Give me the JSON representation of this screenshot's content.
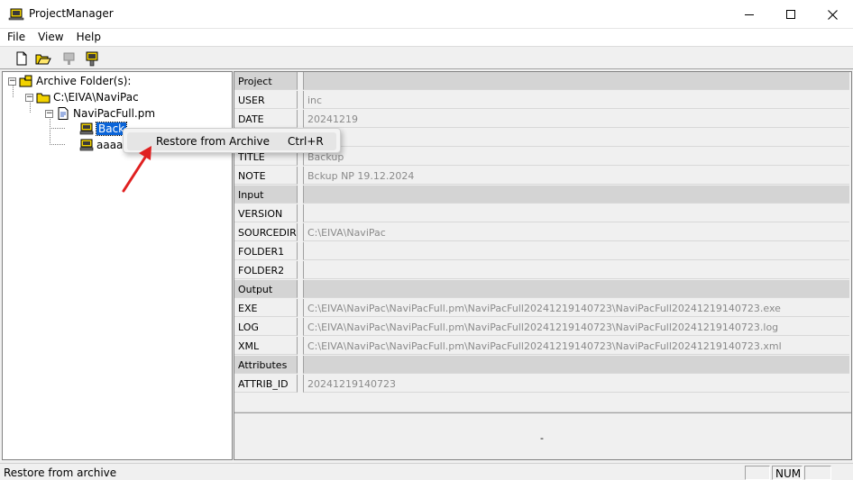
{
  "window": {
    "title": "ProjectManager"
  },
  "menu": {
    "items": [
      "File",
      "View",
      "Help"
    ]
  },
  "toolbar": {
    "buttons": [
      "new-document-icon",
      "open-folder-icon",
      "disconnect-icon",
      "connect-monitor-icon"
    ]
  },
  "tree": {
    "root": "Archive Folder(s):",
    "folder": "C:\\EIVA\\NaviPac",
    "file": "NaviPacFull.pm",
    "archives": [
      "Backup",
      "aaaa"
    ],
    "selected_visible": "Back"
  },
  "context_menu": {
    "item_label": "Restore from Archive",
    "item_shortcut": "Ctrl+R"
  },
  "grid": {
    "rows": [
      {
        "key": "Project",
        "value": "",
        "section": true
      },
      {
        "key": "USER",
        "value": "inc"
      },
      {
        "key": "DATE",
        "value": "20241219"
      },
      {
        "key": "",
        "value": ""
      },
      {
        "key": "TITLE",
        "value": "Backup"
      },
      {
        "key": "NOTE",
        "value": "Bckup NP 19.12.2024"
      },
      {
        "key": "Input",
        "value": "",
        "section": true
      },
      {
        "key": "VERSION",
        "value": ""
      },
      {
        "key": "SOURCEDIR",
        "value": "C:\\EIVA\\NaviPac"
      },
      {
        "key": "FOLDER1",
        "value": ""
      },
      {
        "key": "FOLDER2",
        "value": ""
      },
      {
        "key": "Output",
        "value": "",
        "section": true
      },
      {
        "key": "EXE",
        "value": "C:\\EIVA\\NaviPac\\NaviPacFull.pm\\NaviPacFull20241219140723\\NaviPacFull20241219140723.exe"
      },
      {
        "key": "LOG",
        "value": "C:\\EIVA\\NaviPac\\NaviPacFull.pm\\NaviPacFull20241219140723\\NaviPacFull20241219140723.log"
      },
      {
        "key": "XML",
        "value": "C:\\EIVA\\NaviPac\\NaviPacFull.pm\\NaviPacFull20241219140723\\NaviPacFull20241219140723.xml"
      },
      {
        "key": "Attributes",
        "value": "",
        "section": true
      },
      {
        "key": "ATTRIB_ID",
        "value": "20241219140723"
      }
    ],
    "footer_text": "-"
  },
  "status": {
    "text": "Restore from archive",
    "num_indicator": "NUM"
  },
  "colors": {
    "selection": "#0a64d8",
    "annotation_arrow": "#e02020",
    "section_header": "#d4d4d4"
  }
}
